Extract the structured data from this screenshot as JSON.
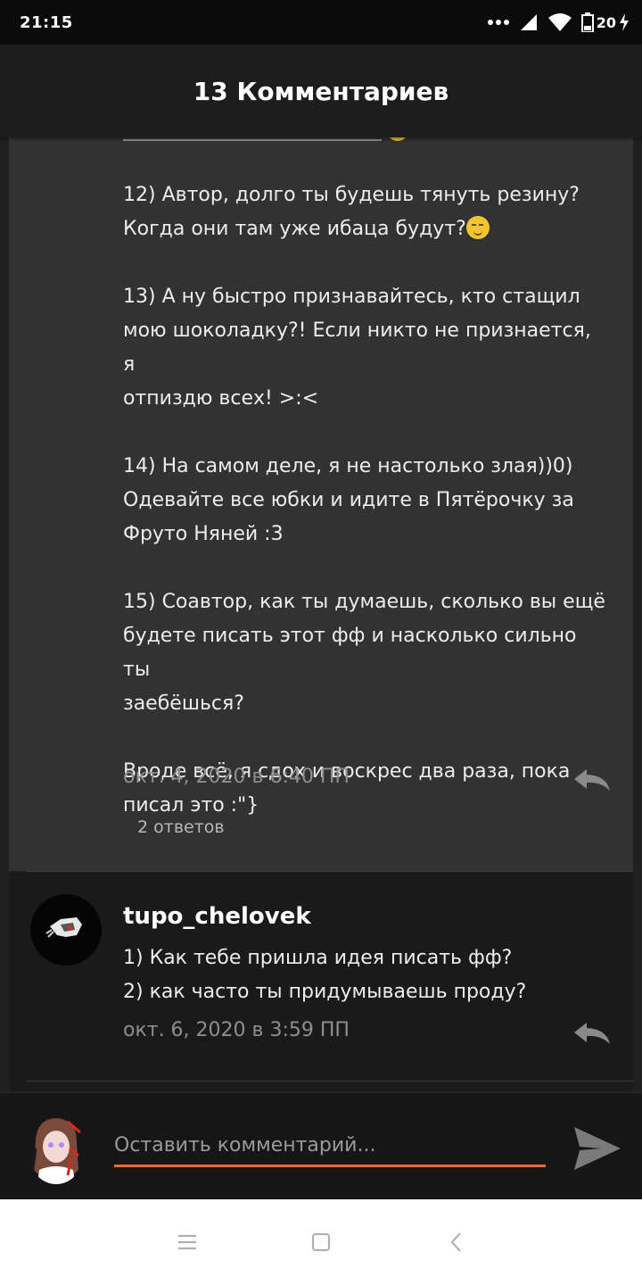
{
  "status": {
    "time": "21:15",
    "battery": "20"
  },
  "header": {
    "title": "13 Комментариев"
  },
  "comment1": {
    "paragraphs": [
      "12) Автор, долго ты будешь тянуть резину?\nКогда они там уже ибаца будут?",
      "13) А ну быстро признавайтесь, кто стащил\nмою шоколадку?! Если никто не признается, я\nотпиздю всех! >:<",
      "14) На самом деле, я не настолько злая))0)\nОдевайте все юбки и идите в Пятёрочку за\nФруто Няней :3",
      "15) Соавтор, как ты думаешь, сколько вы ещё\nбудете писать этот фф и насколько сильно ты\nзаебёшься?",
      "Вроде всё, я сдох и воскрес два раза, пока\nписал это :\"}"
    ],
    "date": "окт. 4, 2020 в 6:40 ПП",
    "replies": "2 ответов"
  },
  "comment2": {
    "username": "tupo_chelovek",
    "line1": "1) Как тебе пришла идея писать фф?",
    "line2": "2) как часто ты придумываешь проду?",
    "date": "окт. 6, 2020 в 3:59 ПП"
  },
  "composer": {
    "placeholder": "Оставить комментарий..."
  },
  "colors": {
    "accent": "#ef6a3a",
    "card_bg": "#323232",
    "header_bg": "#1d1d1d"
  },
  "icons": [
    "signal-icon",
    "wifi-icon",
    "battery-icon",
    "charging-icon",
    "reply-icon",
    "send-icon",
    "menu-icon",
    "home-icon",
    "back-icon"
  ]
}
